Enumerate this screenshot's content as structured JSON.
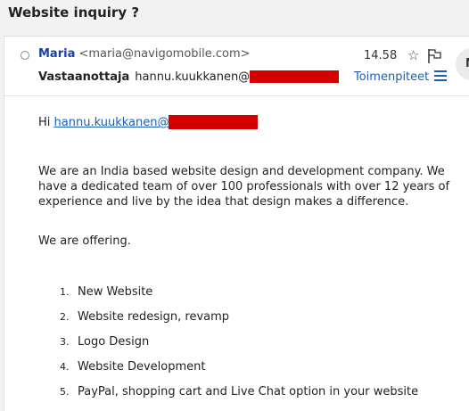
{
  "subject": "Website inquiry ?",
  "message": {
    "sender_name": "Maria",
    "sender_email": "<maria@navigomobile.com>",
    "time": "14.58",
    "recipient_label": "Vastaanottaja",
    "recipient_email": "hannu.kuukkanen@",
    "actions_label": "Toimenpiteet",
    "side_button_label": "M"
  },
  "body": {
    "greeting_prefix": "Hi ",
    "greeting_link": "hannu.kuukkanen@",
    "paragraph": "We are an India based website design and development company. We have a dedicated team of over 100 professionals with over 12 years of experience and live by the idea that design makes a difference.",
    "offering": "We are offering.",
    "list": [
      "New Website",
      "Website redesign, revamp",
      "Logo Design",
      "Website Development",
      "PayPal, shopping cart and Live Chat option in your website"
    ]
  },
  "colors": {
    "accent": "#1a5fb4",
    "sender": "#1a3f9c",
    "redaction": "#d40000"
  },
  "icons": [
    "radio-icon",
    "star-icon",
    "flag-icon",
    "hamburger-icon"
  ]
}
